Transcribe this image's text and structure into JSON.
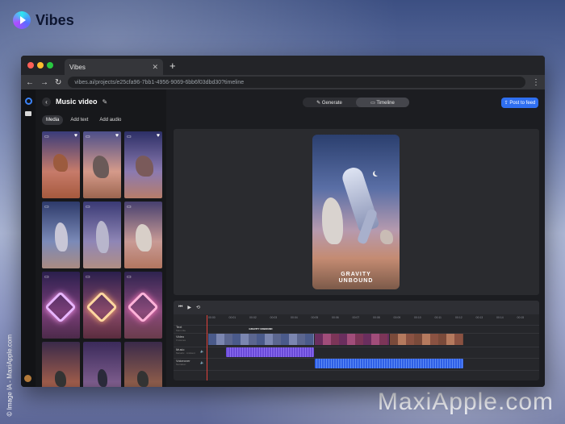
{
  "brand": {
    "name": "Vibes"
  },
  "credit": "© Image IA - MaxiApple.com",
  "watermark": "MaxiApple.com",
  "browser": {
    "tab_title": "Vibes",
    "tab_close": "✕",
    "new_tab": "+",
    "url": "vibes.ai/projects/e25cfa96-7bb1-4956-9069-6bb6f03dbd30?timeline",
    "nav": {
      "back": "←",
      "forward": "→",
      "reload": "↻",
      "menu": "⋮"
    }
  },
  "project": {
    "title": "Music video",
    "back": "‹",
    "edit_icon": "✎",
    "tabs": [
      "Media",
      "Add text",
      "Add audio"
    ]
  },
  "media": {
    "fav_glyph": "♥",
    "type_glyph": "▭",
    "items": [
      "",
      "",
      "",
      "",
      "",
      "",
      "",
      "",
      "",
      "",
      "",
      ""
    ]
  },
  "toolbar": {
    "modes": [
      "✎ Generate",
      "▭ Timeline"
    ],
    "post_label": "⇪ Post to feed"
  },
  "preview": {
    "title_line1": "GRAVITY",
    "title_line2": "UNBOUND"
  },
  "timeline": {
    "controls": [
      "⏮",
      "▶",
      "⟲"
    ],
    "ruler": [
      "00:00",
      "00:01",
      "00:02",
      "00:03",
      "00:04",
      "00:05",
      "00:06",
      "00:07",
      "00:08",
      "00:09",
      "00:10",
      "00:11",
      "00:12",
      "00:13",
      "00:14",
      "00:15"
    ],
    "text_clip": "GRAVITY UNBOUND",
    "tracks": [
      {
        "name": "Text",
        "sub": "Main title"
      },
      {
        "name": "Video",
        "sub": "3 scenes"
      },
      {
        "name": "Music",
        "sub": "Melodic · Ambient"
      },
      {
        "name": "Voiceover",
        "sub": "Narration"
      }
    ],
    "mute_glyph": "🔈"
  },
  "colors": {
    "accent": "#2f6ff0",
    "music": "#7a5ae8",
    "voice": "#2e5fe6",
    "playhead": "#e2423b"
  }
}
